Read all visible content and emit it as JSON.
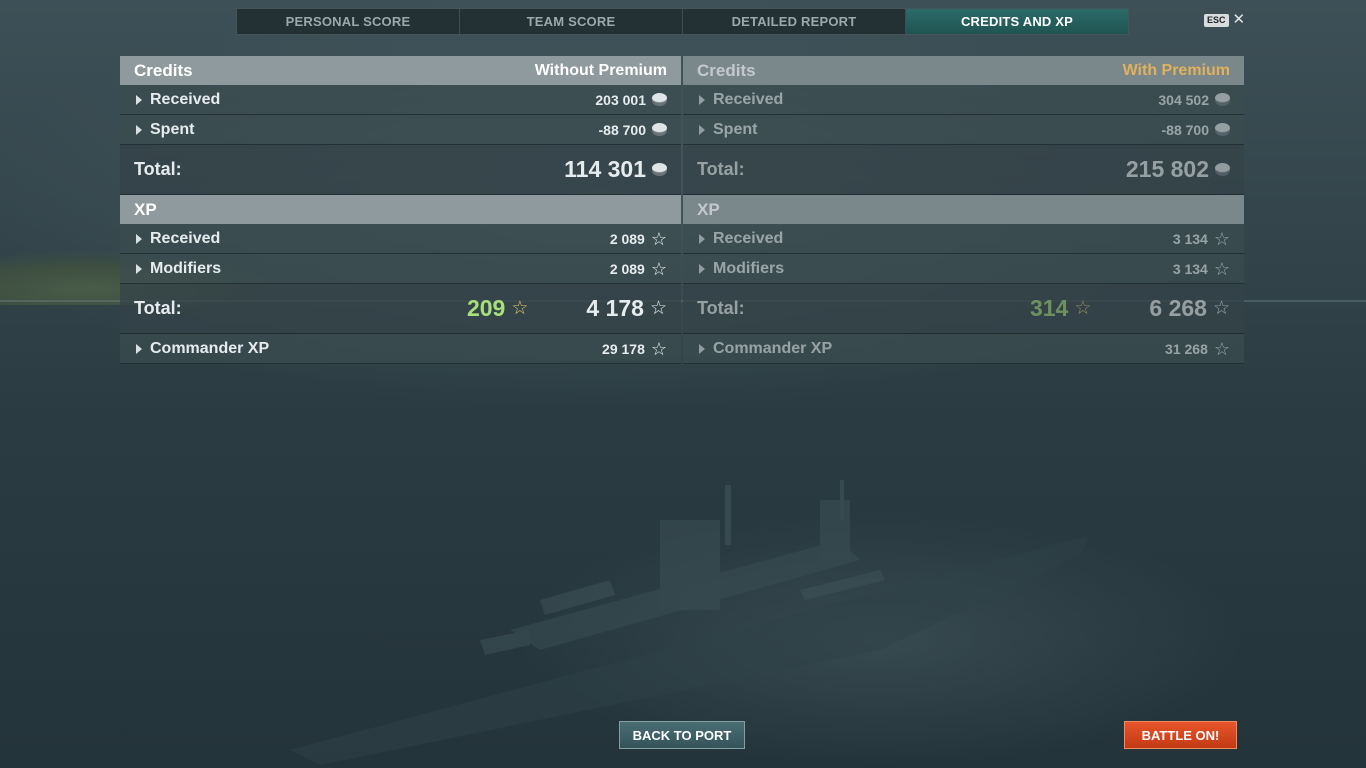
{
  "tabs": [
    {
      "label": "PERSONAL SCORE"
    },
    {
      "label": "TEAM SCORE"
    },
    {
      "label": "DETAILED REPORT"
    },
    {
      "label": "CREDITS AND XP"
    }
  ],
  "esc": {
    "key": "ESC",
    "close": "✕"
  },
  "left": {
    "credits_title": "Credits",
    "mode": "Without Premium",
    "credits_rows": [
      {
        "label": "Received",
        "value": "203 001"
      },
      {
        "label": "Spent",
        "value": "-88 700"
      }
    ],
    "credits_total_label": "Total:",
    "credits_total": "114 301",
    "xp_title": "XP",
    "xp_rows": [
      {
        "label": "Received",
        "value": "2 089"
      },
      {
        "label": "Modifiers",
        "value": "2 089"
      }
    ],
    "xp_total_label": "Total:",
    "xp_base": "209",
    "xp_total": "4 178",
    "commander_label": "Commander XP",
    "commander_value": "29 178"
  },
  "right": {
    "credits_title": "Credits",
    "mode": "With Premium",
    "credits_rows": [
      {
        "label": "Received",
        "value": "304 502"
      },
      {
        "label": "Spent",
        "value": "-88 700"
      }
    ],
    "credits_total_label": "Total:",
    "credits_total": "215 802",
    "xp_title": "XP",
    "xp_rows": [
      {
        "label": "Received",
        "value": "3 134"
      },
      {
        "label": "Modifiers",
        "value": "3 134"
      }
    ],
    "xp_total_label": "Total:",
    "xp_base": "314",
    "xp_total": "6 268",
    "commander_label": "Commander XP",
    "commander_value": "31 268"
  },
  "buttons": {
    "back": "BACK TO PORT",
    "battle": "BATTLE ON!"
  },
  "colors": {
    "active_tab": "#2c6b68",
    "premium": "#e1b25b",
    "battle": "#d9461c",
    "xp_green": "#a6e07a"
  },
  "icons": {
    "credits": "credit-coin-icon",
    "xp": "xp-star-icon",
    "expand": "expand-triangle-icon"
  }
}
